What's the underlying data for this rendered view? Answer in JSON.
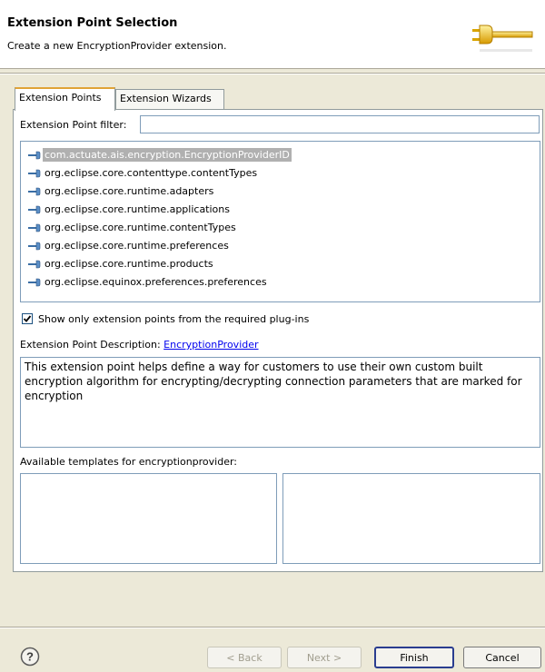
{
  "banner": {
    "title": "Extension Point Selection",
    "description": "Create a new EncryptionProvider extension."
  },
  "tabs": [
    {
      "label": "Extension Points",
      "active": true
    },
    {
      "label": "Extension Wizards",
      "active": false
    }
  ],
  "filter": {
    "label": "Extension Point filter:",
    "value": ""
  },
  "extension_points": [
    {
      "label": "com.actuate.ais.encryption.EncryptionProviderID",
      "selected": true
    },
    {
      "label": "org.eclipse.core.contenttype.contentTypes",
      "selected": false
    },
    {
      "label": "org.eclipse.core.runtime.adapters",
      "selected": false
    },
    {
      "label": "org.eclipse.core.runtime.applications",
      "selected": false
    },
    {
      "label": "org.eclipse.core.runtime.contentTypes",
      "selected": false
    },
    {
      "label": "org.eclipse.core.runtime.preferences",
      "selected": false
    },
    {
      "label": "org.eclipse.core.runtime.products",
      "selected": false
    },
    {
      "label": "org.eclipse.equinox.preferences.preferences",
      "selected": false
    }
  ],
  "show_required": {
    "label": "Show only extension points from the required plug-ins",
    "checked": true
  },
  "description": {
    "label": "Extension Point Description:",
    "link": "EncryptionProvider",
    "text": "This extension point helps define a way for customers to use their own custom built encryption algorithm for encrypting/decrypting connection parameters that are marked for encryption"
  },
  "templates": {
    "label": "Available templates for encryptionprovider:"
  },
  "buttons": {
    "help": "?",
    "back": "< Back",
    "next": "Next >",
    "finish": "Finish",
    "cancel": "Cancel"
  },
  "colors": {
    "dialog_bg": "#ece9d8",
    "selection_bg": "#b0b0b0",
    "link": "#0000ee",
    "icon_blue": "#3a6ea5",
    "plug_gold": "#e8b400"
  },
  "icons": {
    "item_icon": "extension-point-icon",
    "banner_icon": "plug-icon",
    "help_icon": "help-icon"
  }
}
